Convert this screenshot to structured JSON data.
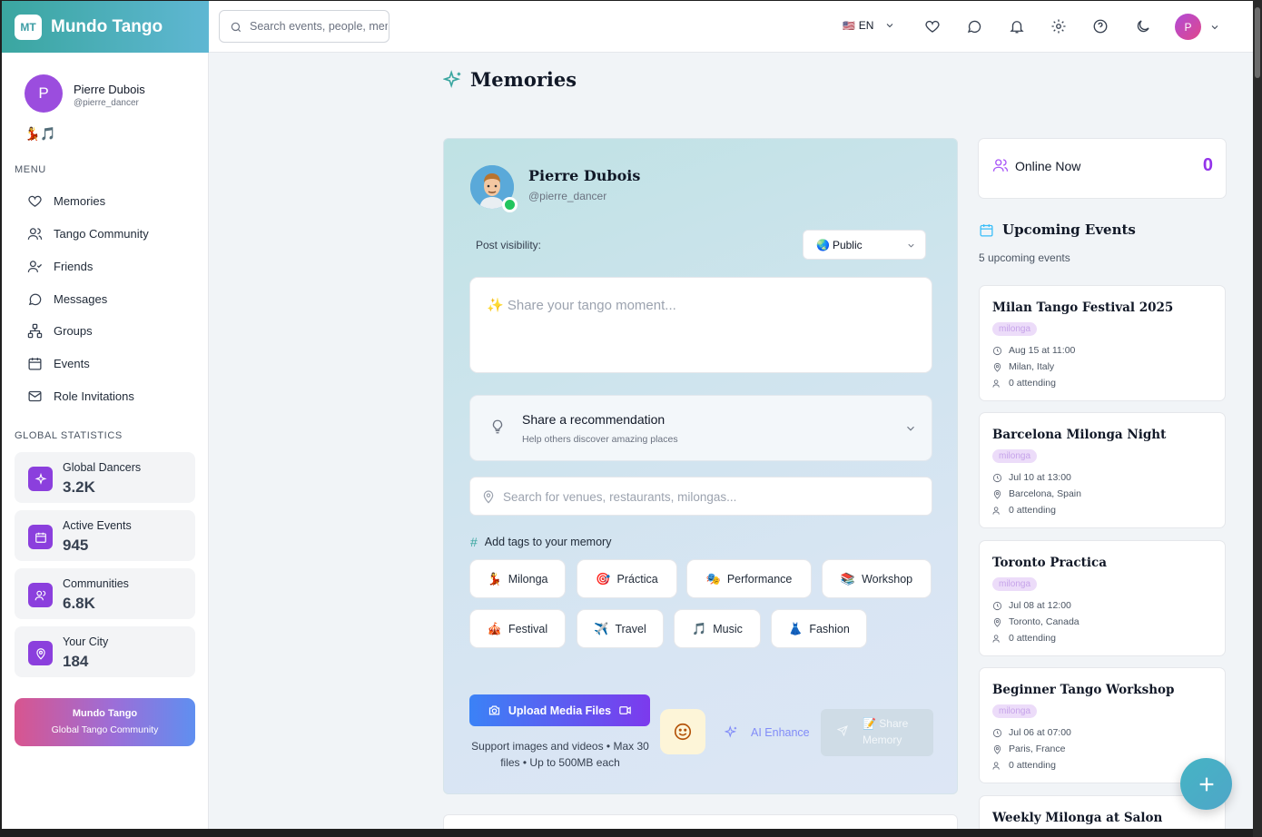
{
  "brand": {
    "badge": "MT",
    "name": "Mundo Tango"
  },
  "profile": {
    "avatar_letter": "P",
    "name": "Pierre Dubois",
    "handle": "@pierre_dancer",
    "emojis": "💃🎵"
  },
  "menu": {
    "label": "MENU",
    "items": [
      {
        "label": "Memories",
        "icon": "heart-icon"
      },
      {
        "label": "Tango Community",
        "icon": "users-icon"
      },
      {
        "label": "Friends",
        "icon": "user-check-icon"
      },
      {
        "label": "Messages",
        "icon": "message-icon"
      },
      {
        "label": "Groups",
        "icon": "network-icon"
      },
      {
        "label": "Events",
        "icon": "calendar-icon"
      },
      {
        "label": "Role Invitations",
        "icon": "mail-icon"
      }
    ]
  },
  "stats": {
    "label": "GLOBAL STATISTICS",
    "items": [
      {
        "label": "Global Dancers",
        "value": "3.2K",
        "icon": "sparkle-icon"
      },
      {
        "label": "Active Events",
        "value": "945",
        "icon": "calendar-icon"
      },
      {
        "label": "Communities",
        "value": "6.8K",
        "icon": "users-icon"
      },
      {
        "label": "Your City",
        "value": "184",
        "icon": "map-pin-icon"
      }
    ]
  },
  "promo": {
    "title": "Mundo Tango",
    "subtitle": "Global Tango Community"
  },
  "header": {
    "search_placeholder": "Search events, people, memories...",
    "lang_flag": "🇺🇸",
    "lang": "EN",
    "avatar_letter": "P"
  },
  "page": {
    "title": "Memories"
  },
  "composer": {
    "name": "Pierre Dubois",
    "handle": "@pierre_dancer",
    "visibility_label": "Post visibility:",
    "visibility_icon": "🌏",
    "visibility_value": "Public",
    "placeholder": "✨ Share your tango moment...",
    "recommend_title": "Share a recommendation",
    "recommend_sub": "Help others discover amazing places",
    "venue_placeholder": "Search for venues, restaurants, milongas...",
    "tags_label": "Add tags to your memory",
    "tags": [
      {
        "icon": "💃",
        "label": "Milonga"
      },
      {
        "icon": "🎯",
        "label": "Práctica"
      },
      {
        "icon": "🎭",
        "label": "Performance"
      },
      {
        "icon": "📚",
        "label": "Workshop"
      },
      {
        "icon": "🎪",
        "label": "Festival"
      },
      {
        "icon": "✈️",
        "label": "Travel"
      },
      {
        "icon": "🎵",
        "label": "Music"
      },
      {
        "icon": "👗",
        "label": "Fashion"
      }
    ],
    "upload_label": "Upload Media Files",
    "upload_note": "Support images and videos • Max 30 files • Up to 500MB each",
    "ai_label": "AI Enhance",
    "share_line1": "📝 Share",
    "share_line2": "Memory"
  },
  "online": {
    "label": "Online Now",
    "count": "0"
  },
  "upcoming": {
    "title": "Upcoming Events",
    "count_text": "5 upcoming events",
    "events": [
      {
        "title": "Milan Tango Festival 2025",
        "tag": "milonga",
        "time": "Aug 15 at 11:00",
        "location": "Milan, Italy",
        "attending": "0 attending"
      },
      {
        "title": "Barcelona Milonga Night",
        "tag": "milonga",
        "time": "Jul 10 at 13:00",
        "location": "Barcelona, Spain",
        "attending": "0 attending"
      },
      {
        "title": "Toronto Practica",
        "tag": "milonga",
        "time": "Jul 08 at 12:00",
        "location": "Toronto, Canada",
        "attending": "0 attending"
      },
      {
        "title": "Beginner Tango Workshop",
        "tag": "milonga",
        "time": "Jul 06 at 07:00",
        "location": "Paris, France",
        "attending": "0 attending"
      },
      {
        "title": "Weekly Milonga at Salon"
      }
    ]
  },
  "colors": {
    "accent": "#8b3fdd",
    "brand_teal": "#3aa6a0",
    "online": "#22c55e",
    "count": "#9333ea"
  }
}
